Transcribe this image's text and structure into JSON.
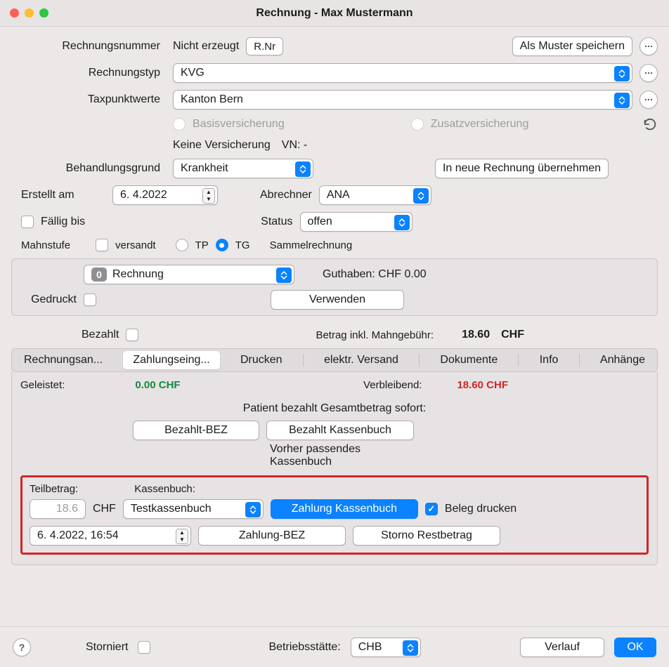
{
  "window": {
    "title": "Rechnung - Max Mustermann"
  },
  "labels": {
    "rechnungsnummer": "Rechnungsnummer",
    "rechnungstyp": "Rechnungstyp",
    "taxpunktwerte": "Taxpunktwerte",
    "behandlungsgrund": "Behandlungsgrund",
    "erstellt_am": "Erstellt am",
    "abrechner": "Abrechner",
    "faellig_bis": "Fällig bis",
    "status": "Status",
    "mahnstufe": "Mahnstufe",
    "versandt": "versandt",
    "tp": "TP",
    "tg": "TG",
    "sammelrechnung": "Sammelrechnung",
    "gedruckt": "Gedruckt",
    "bezahlt": "Bezahlt",
    "betrag_label": "Betrag inkl. Mahngebühr:",
    "geleistet": "Geleistet:",
    "verbleibend": "Verbleibend:",
    "patient_sofort": "Patient bezahlt Gesamtbetrag sofort:",
    "vorher_kassenbuch_1": "Vorher passendes",
    "vorher_kassenbuch_2": "Kassenbuch",
    "teilbetrag": "Teilbetrag:",
    "kassenbuch": "Kassenbuch:",
    "beleg_drucken": "Beleg drucken",
    "storniert": "Storniert",
    "betriebsstaette": "Betriebsstätte:",
    "chf": "CHF"
  },
  "values": {
    "rechnungsnummer_status": "Nicht erzeugt",
    "rechnungstyp": "KVG",
    "taxpunktwerte": "Kanton Bern",
    "basisversicherung": "Basisversicherung",
    "zusatzversicherung": "Zusatzversicherung",
    "keine_versicherung": "Keine Versicherung",
    "vn": "VN: -",
    "behandlungsgrund": "Krankheit",
    "erstellt_am": "6.  4.2022",
    "abrechner": "ANA",
    "status": "offen",
    "mahnstufe_badge": "0",
    "mahnstufe_text": "Rechnung",
    "guthaben": "Guthaben: CHF 0.00",
    "betrag": "18.60",
    "betrag_currency": "CHF",
    "geleistet_value": "0.00 CHF",
    "verbleibend_value": "18.60 CHF",
    "teilbetrag_placeholder": "18.6",
    "kassenbuch_select": "Testkassenbuch",
    "datum_zeit": "6.  4.2022, 16:54",
    "betriebsstaette": "CHB"
  },
  "buttons": {
    "rnr": "R.Nr",
    "als_muster": "Als Muster speichern",
    "in_neue_rechnung": "In neue Rechnung übernehmen",
    "verwenden": "Verwenden",
    "bezahlt_bez": "Bezahlt-BEZ",
    "bezahlt_kassenbuch": "Bezahlt Kassenbuch",
    "zahlung_kassenbuch": "Zahlung Kassenbuch",
    "zahlung_bez": "Zahlung-BEZ",
    "storno_restbetrag": "Storno Restbetrag",
    "verlauf": "Verlauf",
    "ok": "OK"
  },
  "tabs": {
    "rechnungsan": "Rechnungsan...",
    "zahlungseing": "Zahlungseing...",
    "drucken": "Drucken",
    "elektr_versand": "elektr. Versand",
    "dokumente": "Dokumente",
    "info": "Info",
    "anhaenge": "Anhänge"
  }
}
